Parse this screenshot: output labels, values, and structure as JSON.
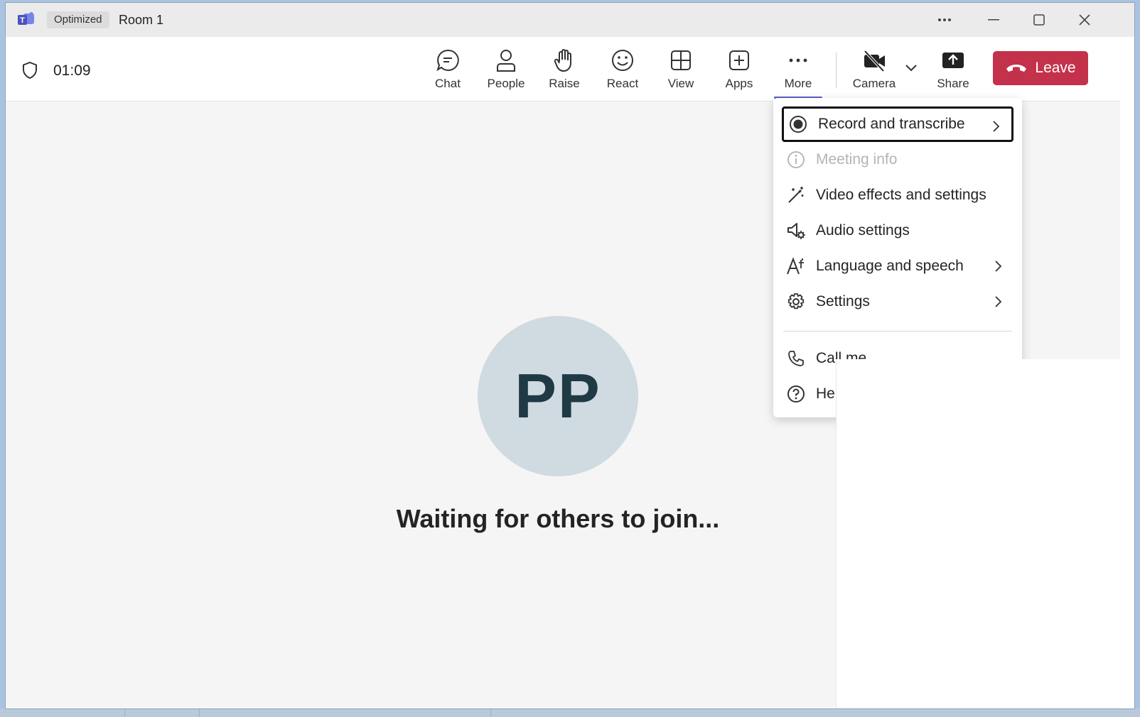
{
  "titlebar": {
    "badge": "Optimized",
    "title": "Room 1"
  },
  "toolbar": {
    "timer": "01:09",
    "buttons": [
      {
        "label": "Chat",
        "icon": "chat-icon"
      },
      {
        "label": "People",
        "icon": "people-icon"
      },
      {
        "label": "Raise",
        "icon": "raise-hand-icon"
      },
      {
        "label": "React",
        "icon": "smiley-icon"
      },
      {
        "label": "View",
        "icon": "grid-icon"
      },
      {
        "label": "Apps",
        "icon": "plus-square-icon"
      },
      {
        "label": "More",
        "icon": "more-dots-icon"
      },
      {
        "label": "Camera",
        "icon": "camera-off-icon"
      },
      {
        "label": "Share",
        "icon": "share-upload-icon"
      }
    ],
    "leave_label": "Leave"
  },
  "stage": {
    "avatar_initials": "PP",
    "waiting_text": "Waiting for others to join..."
  },
  "more_menu": {
    "items": [
      {
        "label": "Record and transcribe",
        "icon": "record-icon",
        "has_submenu": true,
        "focused": true
      },
      {
        "label": "Meeting info",
        "icon": "info-icon",
        "disabled": true
      },
      {
        "label": "Video effects and settings",
        "icon": "magic-wand-icon"
      },
      {
        "label": "Audio settings",
        "icon": "speaker-gear-icon"
      },
      {
        "label": "Language and speech",
        "icon": "language-icon",
        "has_submenu": true
      },
      {
        "label": "Settings",
        "icon": "gear-icon",
        "has_submenu": true
      },
      {
        "label": "Call me",
        "icon": "phone-icon"
      },
      {
        "label": "Help",
        "icon": "help-icon"
      }
    ],
    "partial_visible": {
      "call": "Call me",
      "help": "He"
    }
  },
  "colors": {
    "leave": "#c4314b",
    "accent": "#5b5fc7"
  }
}
